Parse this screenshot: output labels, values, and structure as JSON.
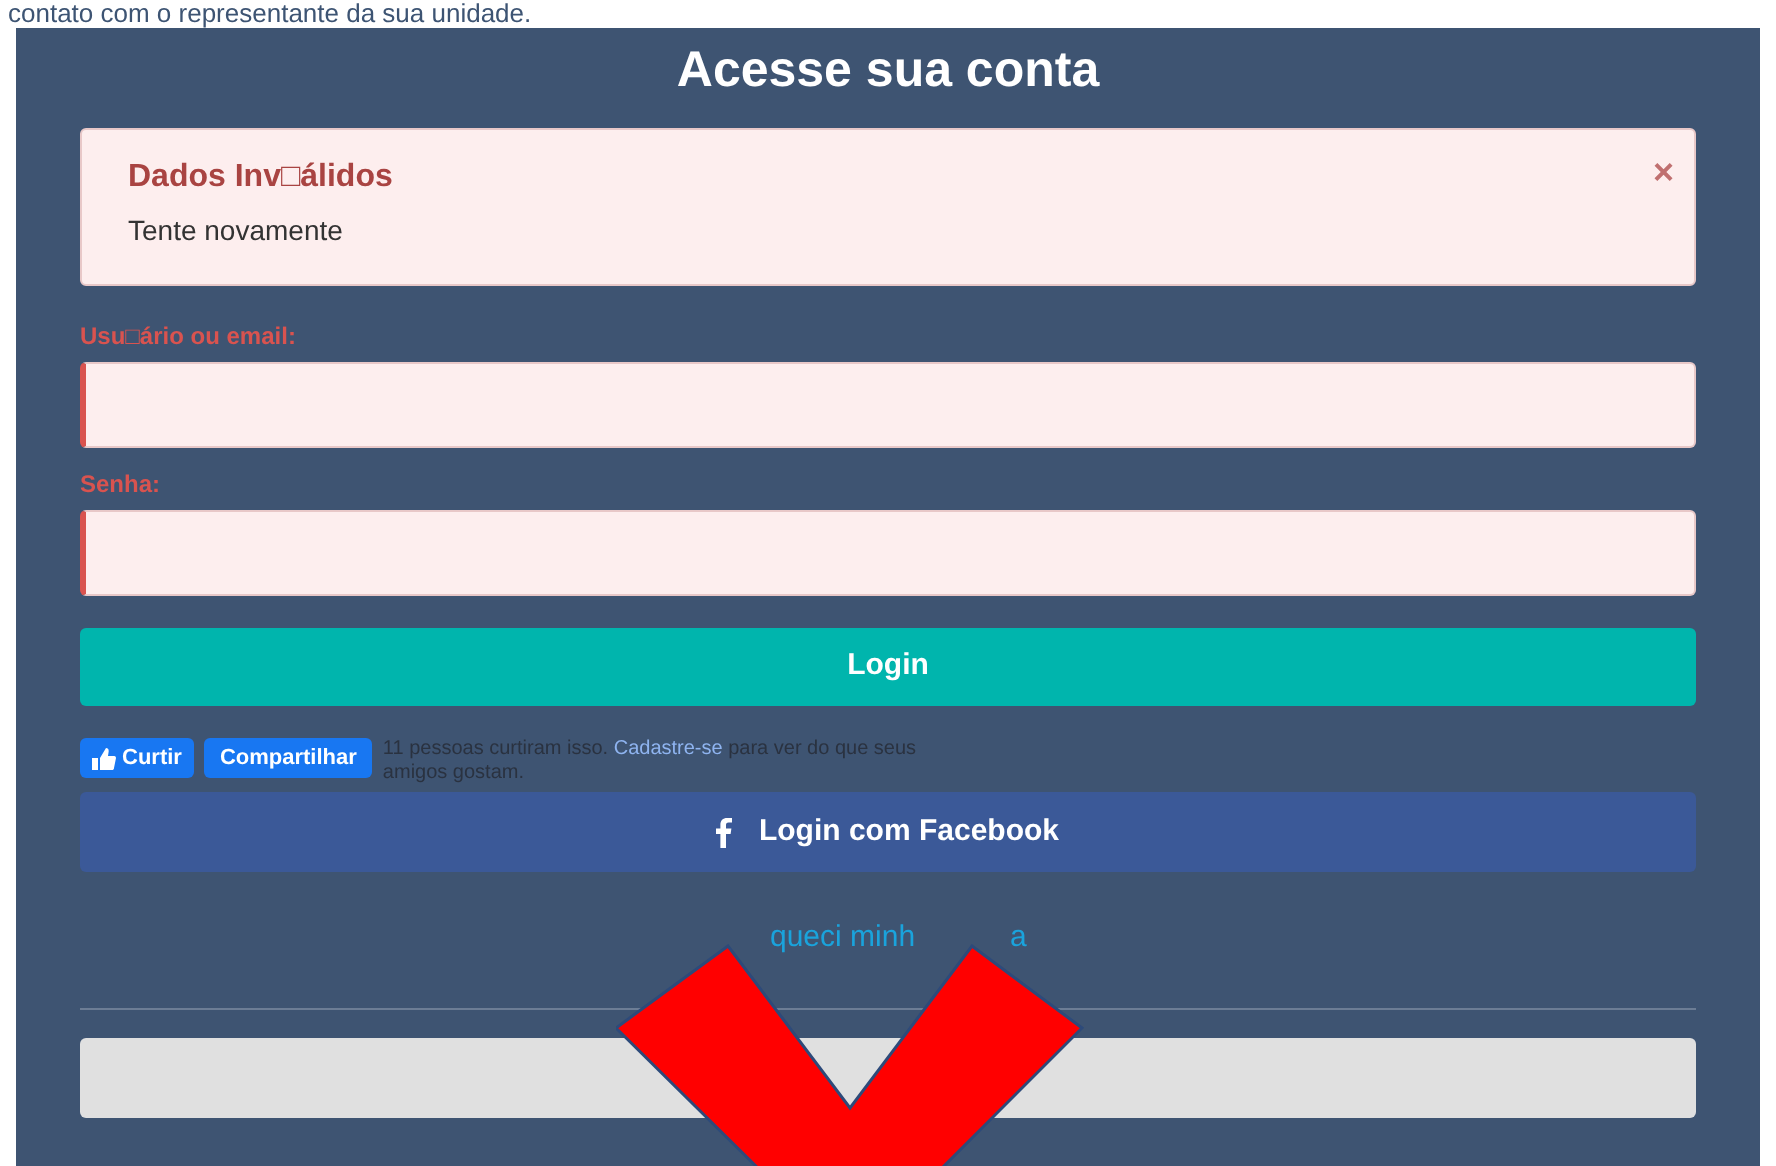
{
  "top_text": "contato com o representante da sua unidade.",
  "title": "Acesse sua conta",
  "alert": {
    "title": "Dados Inv□álidos",
    "message": "Tente novamente",
    "close": "×"
  },
  "fields": [
    {
      "label": "Usu□ário ou email:",
      "invalid": true
    },
    {
      "label": "Senha:",
      "invalid": true
    }
  ],
  "login_button": "Login",
  "social": {
    "like": "Curtir",
    "share": "Compartilhar",
    "text_before": "11 pessoas curtiram isso.",
    "link": "Cadastre-se",
    "text_after": "para ver do que seus amigos gostam."
  },
  "facebook_button": "Login com Facebook",
  "forgot_link_parts": [
    "queci minh",
    "a"
  ]
}
